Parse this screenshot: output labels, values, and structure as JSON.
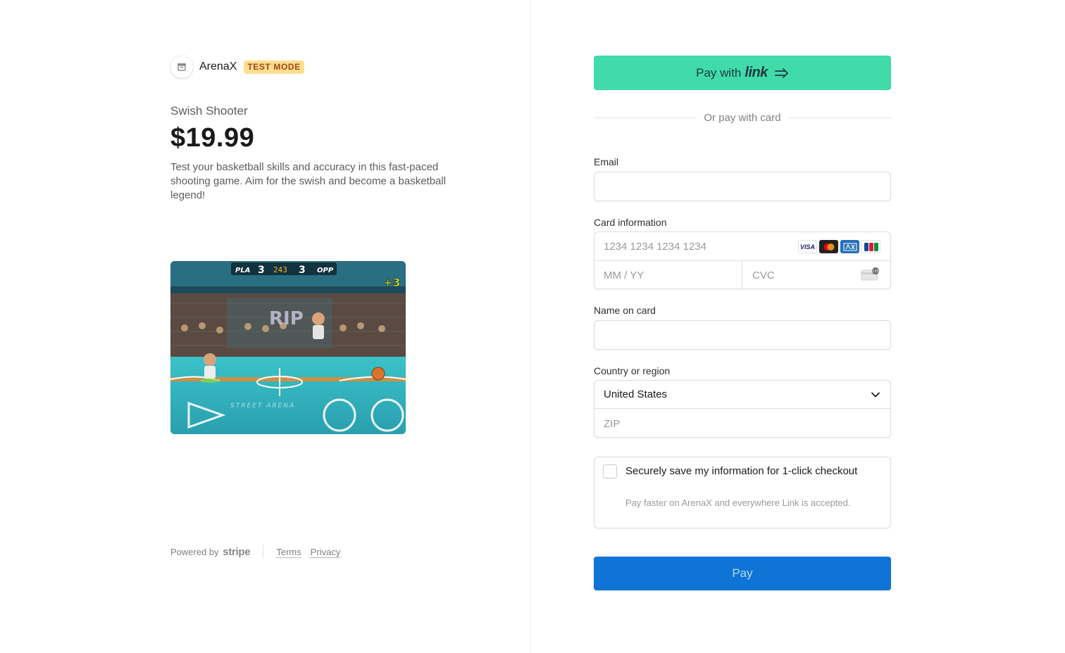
{
  "merchant": {
    "name": "ArenaX",
    "mode_badge": "TEST MODE"
  },
  "product": {
    "name": "Swish Shooter",
    "price": "$19.99",
    "description": "Test your basketball skills and accuracy in this fast-paced shooting game. Aim for the swish and become a basketball legend!",
    "image_hud": {
      "left_team": "PLA",
      "left_score": "3",
      "timer": "243",
      "right_score": "3",
      "right_team": "OPP",
      "bonus": "+3",
      "court_text": "STREET ARENA"
    }
  },
  "footer": {
    "powered_by": "Powered by",
    "stripe": "stripe",
    "terms": "Terms",
    "privacy": "Privacy"
  },
  "checkout": {
    "link_button": {
      "prefix": "Pay with",
      "brand": "link"
    },
    "or_text": "Or pay with card",
    "email_label": "Email",
    "email_value": "",
    "card_label": "Card information",
    "card_number_placeholder": "1234 1234 1234 1234",
    "card_brands": [
      "VISA",
      "Mastercard",
      "AMEX",
      "JCB"
    ],
    "expiry_placeholder": "MM / YY",
    "cvc_placeholder": "CVC",
    "name_label": "Name on card",
    "name_value": "",
    "country_label": "Country or region",
    "country_value": "United States",
    "zip_placeholder": "ZIP",
    "save_title": "Securely save my information for 1-click checkout",
    "save_subtitle": "Pay faster on ArenaX and everywhere Link is accepted.",
    "save_checked": false,
    "pay_label": "Pay"
  },
  "colors": {
    "link_green": "#40dba9",
    "pay_blue": "#0e74d6",
    "test_badge_bg": "#ffde92",
    "test_badge_text": "#a2470c"
  }
}
